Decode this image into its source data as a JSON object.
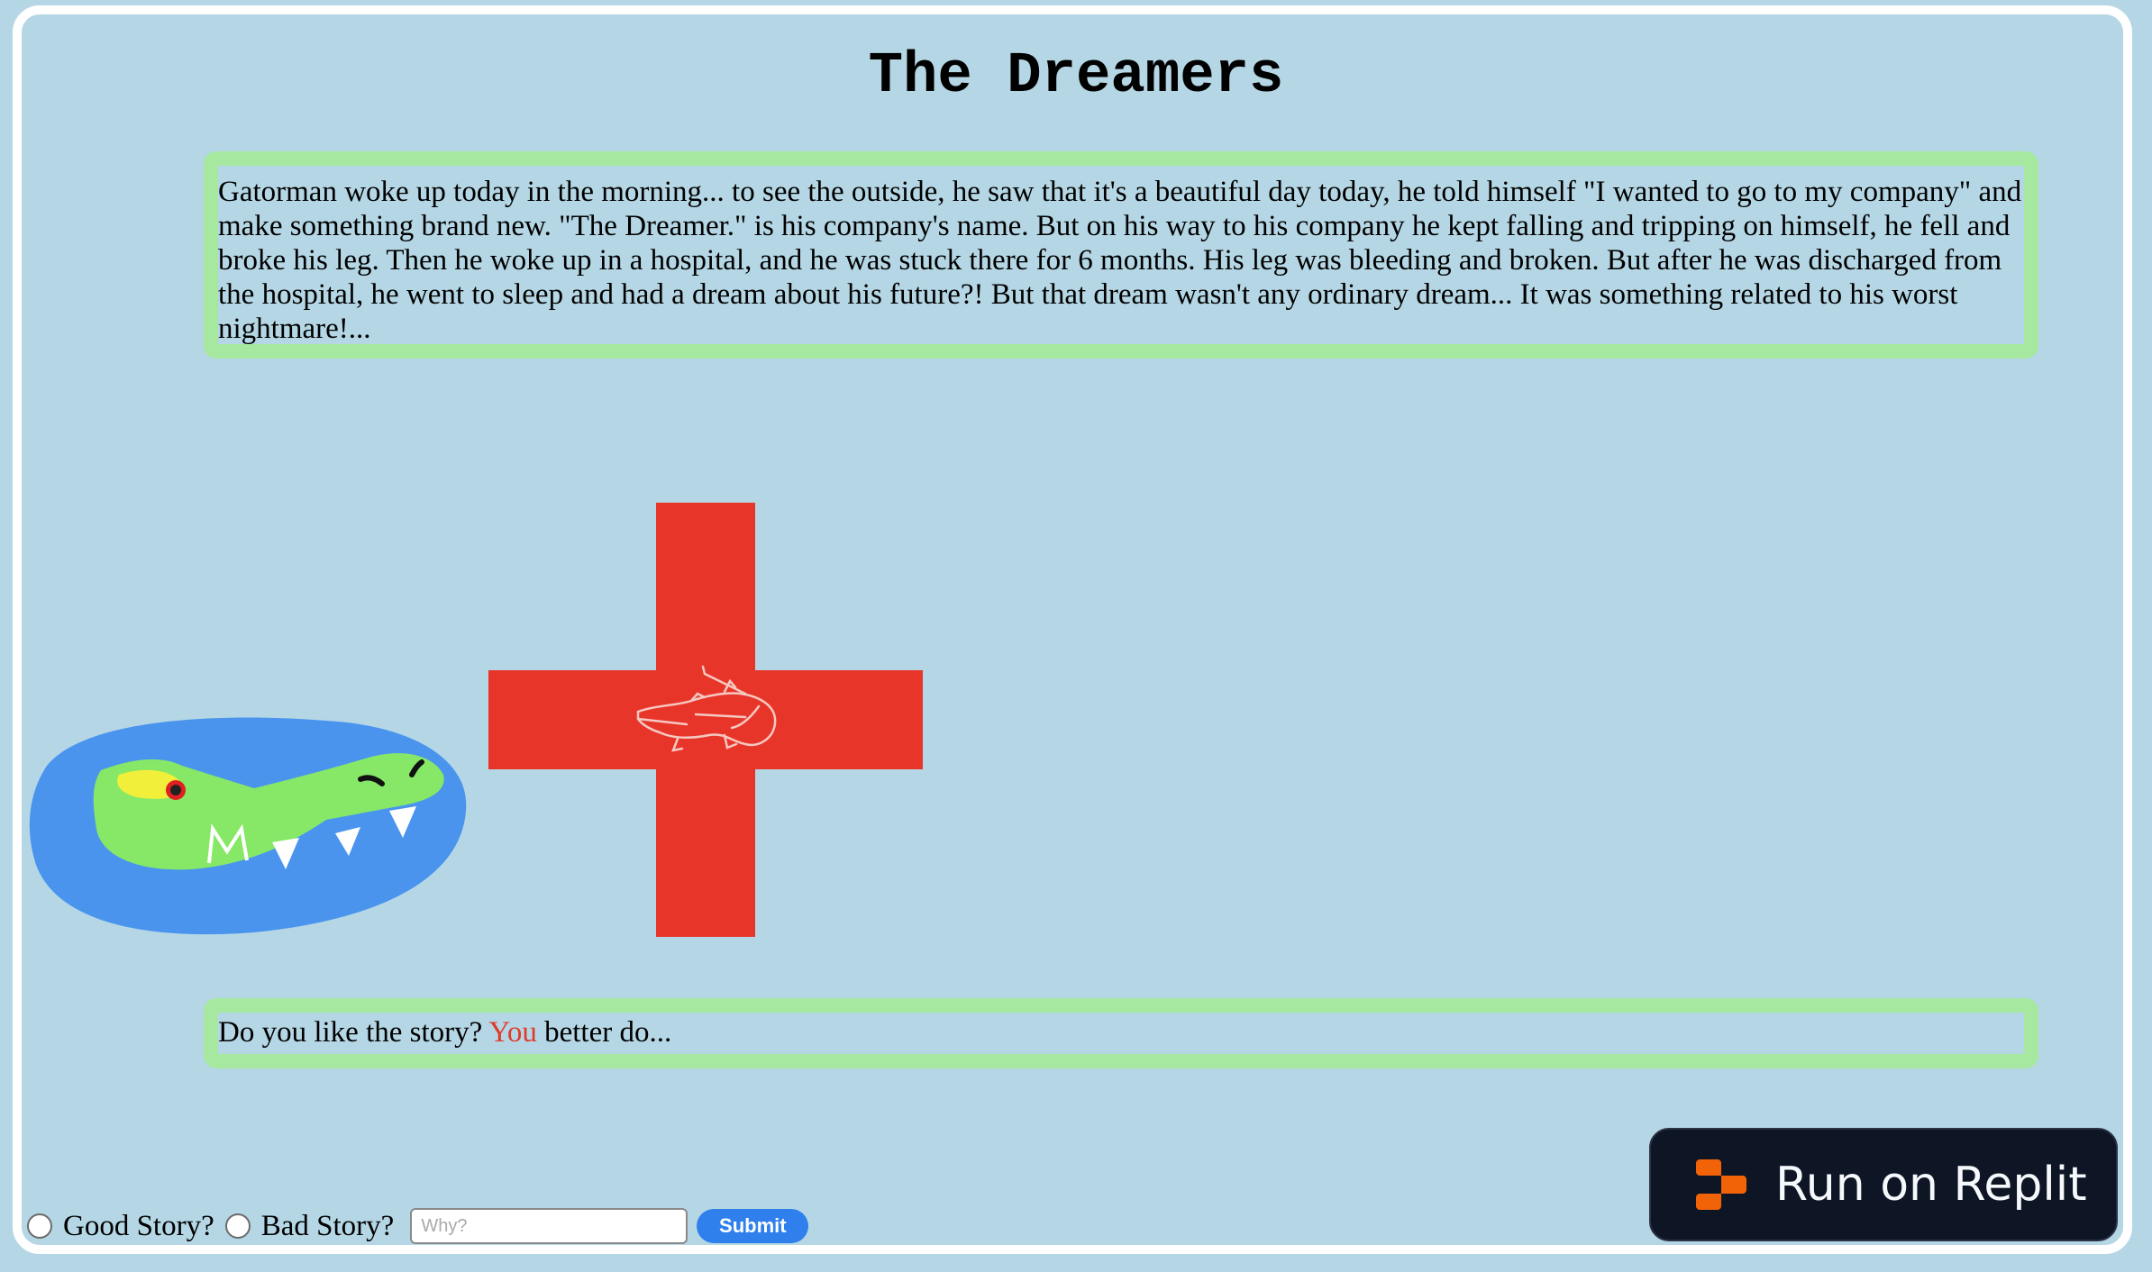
{
  "page": {
    "title": "The Dreamers",
    "story": "Gatorman woke up today in the morning... to see the outside, he saw that it's a beautiful day today, he told himself \"I wanted to go to my company\" and make something brand new. \"The Dreamer.\" is his company's name. But on his way to his company he kept falling and tripping on himself, he fell and broke his leg. Then he woke up in a hospital, and he was stuck there for 6 months. His leg was bleeding and broken. But after he was discharged from the hospital, he went to sleep and had a dream about his future?! But that dream wasn't any ordinary dream... It was something related to his worst nightmare!...",
    "question_prefix": "Do you like the story?",
    "question_accent": "You",
    "question_suffix": "better do..."
  },
  "images": {
    "gator": "alligator-drawing",
    "cross": "red-cross-with-alligator-icon"
  },
  "form": {
    "good_label": "Good Story?",
    "bad_label": "Bad Story?",
    "why_placeholder": "Why?",
    "submit_label": "Submit"
  },
  "replit": {
    "label": "Run on Replit"
  },
  "colors": {
    "background": "#b5d7e5",
    "box_border": "#a6e8a0",
    "accent_red": "#e03a2c",
    "submit_blue": "#2f80ed",
    "replit_dark": "#0e1525",
    "replit_orange": "#f26207"
  }
}
